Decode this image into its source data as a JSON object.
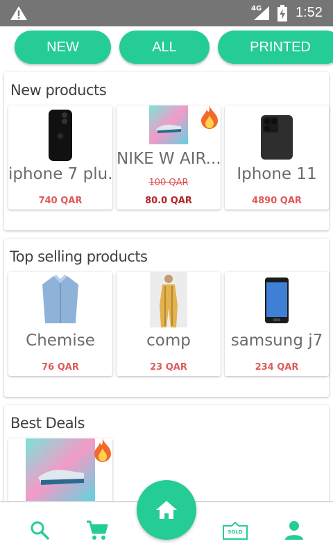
{
  "status_bar": {
    "network": "4G",
    "time": "1:52"
  },
  "filters": [
    {
      "label": "NEW"
    },
    {
      "label": "ALL"
    },
    {
      "label": "PRINTED"
    }
  ],
  "sections": {
    "new_products": {
      "title": "New products",
      "items": [
        {
          "name": "iphone 7 plu...",
          "price": "740 QAR"
        },
        {
          "name": "NIKE W AIR...",
          "old_price": "100 QAR",
          "price": "80.0 QAR"
        },
        {
          "name": "Iphone 11",
          "price": "4890 QAR"
        }
      ]
    },
    "top_selling": {
      "title": "Top selling products",
      "items": [
        {
          "name": "Chemise",
          "price": "76 QAR"
        },
        {
          "name": "comp",
          "price": "23 QAR"
        },
        {
          "name": "samsung j7",
          "price": "234 QAR"
        }
      ]
    },
    "best_deals": {
      "title": "Best Deals"
    }
  },
  "bottom_nav": {
    "sold_label": "SOLD"
  },
  "colors": {
    "accent": "#26cc96",
    "price": "#e05a5a",
    "sale_price": "#b3262a",
    "status_bar": "#757575"
  }
}
